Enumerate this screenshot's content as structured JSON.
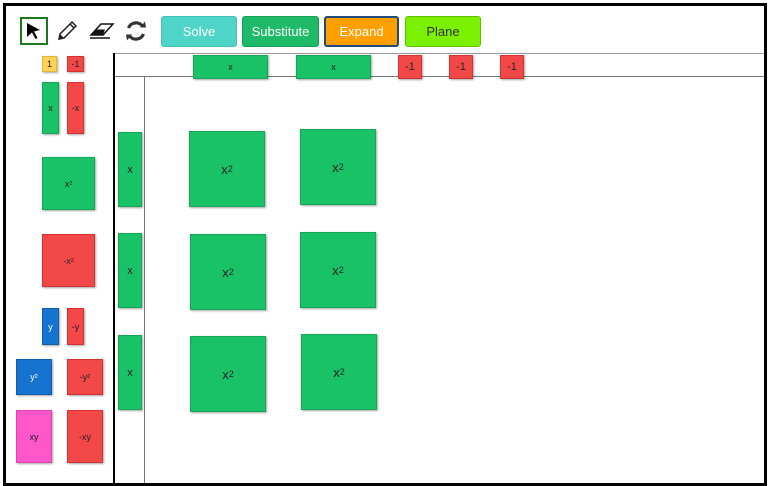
{
  "toolbar": {
    "tools": [
      {
        "name": "select-tool",
        "icon": "cursor-arrow-icon"
      },
      {
        "name": "pencil-tool",
        "icon": "pencil-icon"
      },
      {
        "name": "eraser-tool",
        "icon": "eraser-icon"
      },
      {
        "name": "reset-tool",
        "icon": "refresh-icon"
      }
    ],
    "solve_label": "Solve",
    "substitute_label": "Substitute",
    "expand_label": "Expand",
    "plane_label": "Plane"
  },
  "palette": {
    "one": "1",
    "neg_one": "-1",
    "x": "x",
    "neg_x": "-x",
    "x2": "x²",
    "neg_x2": "-x²",
    "y": "y",
    "neg_y": "-y",
    "y2": "y²",
    "neg_y2": "-y²",
    "xy": "xy",
    "neg_xy": "-xy"
  },
  "top_factor": {
    "x_tiles": [
      "x",
      "x"
    ],
    "unit_tiles": [
      "-1",
      "-1",
      "-1"
    ]
  },
  "left_factor": {
    "x_tiles": [
      "x",
      "x",
      "x"
    ]
  },
  "product": {
    "base": "x",
    "exponent": "2",
    "count": 6
  },
  "colors": {
    "positive": "#19c266",
    "negative": "#f34848",
    "unit": "#ffd257",
    "y": "#1673cf",
    "xy": "#ff57c9"
  }
}
